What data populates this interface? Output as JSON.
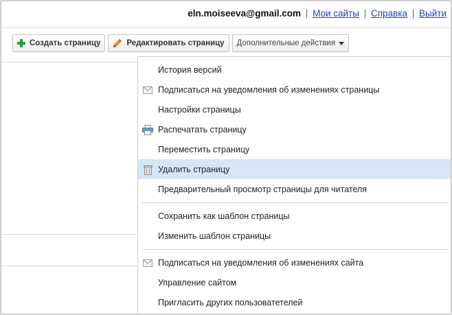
{
  "account": {
    "email": "eln.moiseeva@gmail.com",
    "sep": "|",
    "links": [
      "Мои сайты",
      "Справка",
      "Выйти"
    ]
  },
  "toolbar": {
    "create_label": "Создать страницу",
    "edit_label": "Редактировать страницу",
    "more_label": "Дополнительные действия"
  },
  "menu": {
    "items": [
      {
        "label": "История версий",
        "icon": ""
      },
      {
        "label": "Подписаться на уведомления об изменениях страницы",
        "icon": "envelope-icon"
      },
      {
        "label": "Настройки страницы",
        "icon": ""
      },
      {
        "label": "Распечатать страницу",
        "icon": "printer-icon"
      },
      {
        "label": "Переместить страницу",
        "icon": ""
      },
      {
        "label": "Удалить страницу",
        "icon": "trash-icon",
        "highlighted": true
      },
      {
        "label": "Предварительный просмотр страницы для читателя",
        "icon": ""
      },
      {
        "label": "Сохранить как шаблон страницы",
        "icon": ""
      },
      {
        "label": "Изменить шаблон страницы",
        "icon": ""
      },
      {
        "label": "Подписаться на уведомления об изменениях сайта",
        "icon": "envelope-icon"
      },
      {
        "label": "Управление сайтом",
        "icon": ""
      },
      {
        "label": "Пригласить других пользоватетелей",
        "icon": ""
      }
    ]
  },
  "colors": {
    "highlight": "#d7e6f5",
    "link": "#1a3fc4",
    "plus_icon": "#2e9b2e",
    "pencil_icon": "#e08a1e"
  }
}
